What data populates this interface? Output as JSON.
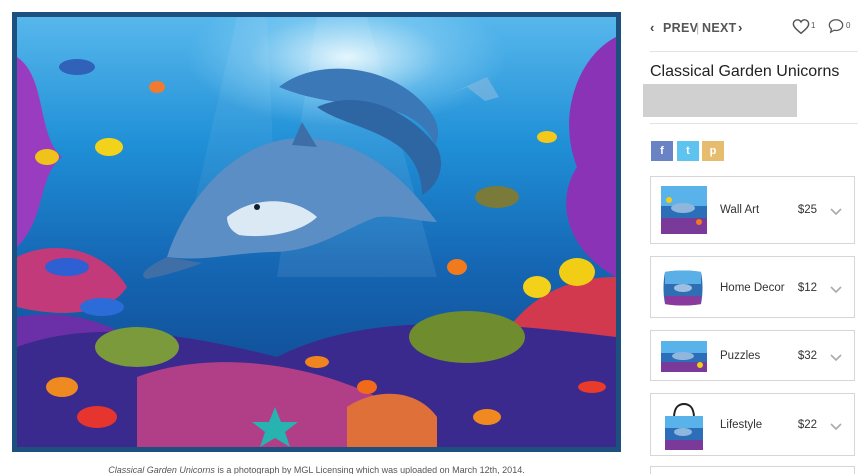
{
  "artwork": {
    "title_italic": "Classical Garden Unicorns",
    "caption_rest": " is a photograph by MGL Licensing which was uploaded on March 12th, 2014."
  },
  "nav": {
    "prev_label": "PREV",
    "separator": "|",
    "next_label": "NEXT",
    "favorites_count": "1",
    "comments_count": "0"
  },
  "product": {
    "title": "Classical Garden Unicorns"
  },
  "share": {
    "facebook": "f",
    "twitter": "t",
    "pinterest": "p"
  },
  "products": [
    {
      "label": "Wall Art",
      "price": "$25"
    },
    {
      "label": "Home Decor",
      "price": "$12"
    },
    {
      "label": "Puzzles",
      "price": "$32"
    },
    {
      "label": "Lifestyle",
      "price": "$22"
    }
  ],
  "colors": {
    "frame": "#1d4f7f",
    "facebook": "#6a83c4",
    "twitter": "#5ec4ef",
    "pinterest": "#e6bd6e"
  }
}
